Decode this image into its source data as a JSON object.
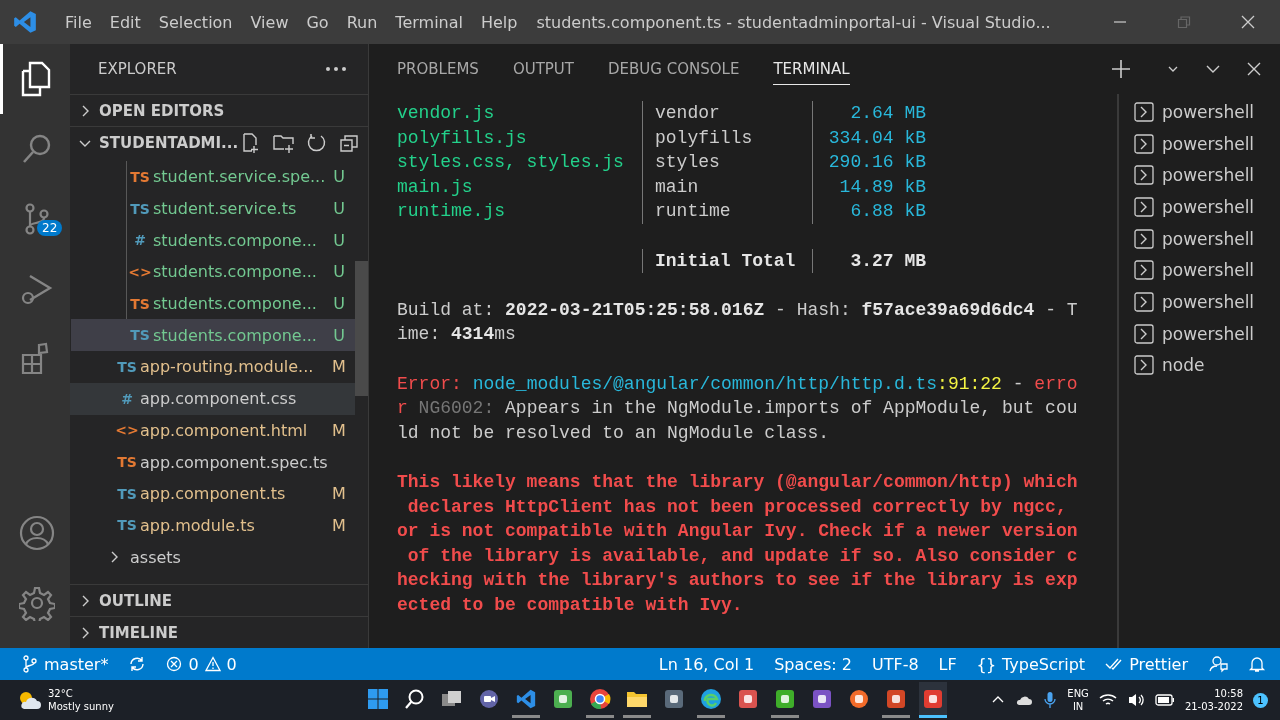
{
  "window": {
    "title": "students.component.ts - studentadminportal-ui - Visual Studio...",
    "menu": [
      "File",
      "Edit",
      "Selection",
      "View",
      "Go",
      "Run",
      "Terminal",
      "Help"
    ]
  },
  "activity_bar": {
    "items": [
      {
        "kind": "explorer",
        "selected": true
      },
      {
        "kind": "search",
        "selected": false
      },
      {
        "kind": "scm",
        "selected": false,
        "badge": "22"
      },
      {
        "kind": "debug",
        "selected": false
      },
      {
        "kind": "extensions",
        "selected": false
      }
    ],
    "bottom": [
      {
        "kind": "account"
      },
      {
        "kind": "settings"
      }
    ]
  },
  "sidebar": {
    "title": "EXPLORER",
    "sections": [
      {
        "title": "OPEN EDITORS",
        "expanded": false
      },
      {
        "title": "STUDENTADMI...",
        "expanded": true
      }
    ],
    "tree": [
      {
        "children": [
          {
            "icon": "TS",
            "color": "#e37933",
            "name": "student.service.spe...",
            "status": "U",
            "kind": "untracked",
            "selected": false,
            "hovered": false
          },
          {
            "icon": "TS",
            "color": "#519aba",
            "name": "student.service.ts",
            "status": "U",
            "kind": "untracked",
            "selected": false,
            "hovered": false
          },
          {
            "icon": "#",
            "color": "#519aba",
            "name": "students.compone...",
            "status": "U",
            "kind": "untracked",
            "selected": false,
            "hovered": false
          },
          {
            "icon": "<>",
            "color": "#e37933",
            "name": "students.compone...",
            "status": "U",
            "kind": "untracked",
            "selected": false,
            "hovered": false
          },
          {
            "icon": "TS",
            "color": "#e37933",
            "name": "students.compone...",
            "status": "U",
            "kind": "untracked",
            "selected": false,
            "hovered": false
          },
          {
            "icon": "TS",
            "color": "#519aba",
            "name": "students.compone...",
            "status": "U",
            "kind": "untracked",
            "selected": true,
            "hovered": false
          }
        ]
      },
      {
        "icon": "TS",
        "color": "#519aba",
        "name": "app-routing.module...",
        "status": "M",
        "kind": "modified",
        "selected": false,
        "hovered": false
      },
      {
        "icon": "#",
        "color": "#519aba",
        "name": "app.component.css",
        "kind": "clean",
        "selected": false,
        "hovered": true
      },
      {
        "icon": "<>",
        "color": "#e37933",
        "name": "app.component.html",
        "status": "M",
        "kind": "modified",
        "selected": false,
        "hovered": false
      },
      {
        "icon": "TS",
        "color": "#e37933",
        "name": "app.component.spec.ts",
        "kind": "clean",
        "selected": false,
        "hovered": false
      },
      {
        "icon": "TS",
        "color": "#519aba",
        "name": "app.component.ts",
        "status": "M",
        "kind": "modified",
        "selected": false,
        "hovered": false
      },
      {
        "icon": "TS",
        "color": "#519aba",
        "name": "app.module.ts",
        "status": "M",
        "kind": "modified",
        "selected": false,
        "hovered": false
      },
      {
        "name": "assets",
        "kind": "clean",
        "expanded": false,
        "selected": false,
        "hovered": false
      }
    ],
    "bottom_sections": [
      {
        "title": "OUTLINE",
        "expanded": false
      },
      {
        "title": "TIMELINE",
        "expanded": false
      }
    ]
  },
  "panel": {
    "tabs": [
      {
        "label": "PROBLEMS",
        "selected": false
      },
      {
        "label": "OUTPUT",
        "selected": false
      },
      {
        "label": "DEBUG CONSOLE",
        "selected": false
      },
      {
        "label": "TERMINAL",
        "selected": true
      }
    ],
    "bundles": [
      {
        "file": "vendor.js",
        "chunk": "vendor",
        "size": "2.64 MB"
      },
      {
        "file": "polyfills.js",
        "chunk": "polyfills",
        "size": "334.04 kB"
      },
      {
        "file": "styles.css, styles.js",
        "chunk": "styles",
        "size": "290.16 kB"
      },
      {
        "file": "main.js",
        "chunk": "main",
        "size": "14.89 kB"
      },
      {
        "file": "runtime.js",
        "chunk": "runtime",
        "size": "6.88 kB"
      }
    ],
    "total": {
      "label": "Initial Total",
      "size": "3.27 MB"
    },
    "blocks": [
      [
        [
          {
            "kind": "plain",
            "text": "Build at: "
          },
          {
            "kind": "bold",
            "text": "2022-03-21T05:25:58.016Z"
          },
          {
            "kind": "plain",
            "text": " - Hash: "
          },
          {
            "kind": "bold",
            "text": "f57ace39a69d6dc4"
          },
          {
            "kind": "plain",
            "text": " - T"
          }
        ],
        [
          {
            "kind": "plain",
            "text": "ime: "
          },
          {
            "kind": "bold",
            "text": "4314"
          },
          {
            "kind": "plain",
            "text": "ms"
          }
        ]
      ],
      [
        [
          {
            "kind": "red",
            "text": "Error: "
          },
          {
            "kind": "cyan",
            "text": "node_modules/@angular/common/http/http.d.ts"
          },
          {
            "kind": "yellow",
            "text": ":91:22"
          },
          {
            "kind": "plain",
            "text": " - "
          },
          {
            "kind": "red",
            "text": "erro"
          }
        ],
        [
          {
            "kind": "red",
            "text": "r"
          },
          {
            "kind": "grey",
            "text": " NG6002:"
          },
          {
            "kind": "plain",
            "text": " Appears in the NgModule.imports of AppModule, but cou"
          }
        ],
        [
          {
            "kind": "plain",
            "text": "ld not be resolved to an NgModule class."
          }
        ]
      ],
      [
        [
          {
            "kind": "redbold",
            "text": "This likely means that the library (@angular/common/http) which"
          }
        ],
        [
          {
            "kind": "redbold",
            "text": " declares HttpClient has not been processed correctly by ngcc,"
          }
        ],
        [
          {
            "kind": "redbold",
            "text": "or is not compatible with Angular Ivy. Check if a newer version"
          }
        ],
        [
          {
            "kind": "redbold",
            "text": " of the library is available, and update if so. Also consider c"
          }
        ],
        [
          {
            "kind": "redbold",
            "text": "hecking with the library's authors to see if the library is exp"
          }
        ],
        [
          {
            "kind": "redbold",
            "text": "ected to be compatible with Ivy."
          }
        ]
      ]
    ],
    "terminals": [
      {
        "name": "powershell",
        "selected": false
      },
      {
        "name": "powershell",
        "selected": false
      },
      {
        "name": "powershell",
        "selected": false
      },
      {
        "name": "powershell",
        "selected": false
      },
      {
        "name": "powershell",
        "selected": false
      },
      {
        "name": "powershell",
        "selected": false
      },
      {
        "name": "powershell",
        "selected": false
      },
      {
        "name": "powershell",
        "selected": false
      },
      {
        "name": "node",
        "selected": false
      }
    ]
  },
  "status_bar": {
    "branch": "master*",
    "errors": "0",
    "warnings": "0",
    "right": [
      {
        "kind": "text",
        "text": "Ln 16, Col 1"
      },
      {
        "kind": "text",
        "text": "Spaces: 2"
      },
      {
        "kind": "text",
        "text": "UTF-8"
      },
      {
        "kind": "text",
        "text": "LF"
      },
      {
        "kind": "braces",
        "text": "TypeScript",
        "glyph": "{}"
      },
      {
        "kind": "checks",
        "text": "Prettier"
      },
      {
        "kind": "feedback"
      },
      {
        "kind": "bell"
      }
    ]
  },
  "taskbar": {
    "weather": {
      "temp": "32°C",
      "text": "Mostly sunny"
    },
    "apps": [
      {
        "kind": "windows",
        "running": false,
        "selected": false
      },
      {
        "kind": "search",
        "running": false,
        "selected": false
      },
      {
        "kind": "taskview",
        "running": false,
        "selected": false
      },
      {
        "kind": "chat",
        "running": false,
        "selected": false
      },
      {
        "kind": "vscode",
        "running": true,
        "selected": false
      },
      {
        "kind": "notepad",
        "running": false,
        "selected": false
      },
      {
        "kind": "chrome",
        "running": true,
        "selected": false
      },
      {
        "kind": "folder",
        "running": true,
        "selected": false
      },
      {
        "kind": "calculator",
        "running": false,
        "selected": false
      },
      {
        "kind": "edge",
        "running": true,
        "selected": false
      },
      {
        "kind": "snip",
        "running": false,
        "selected": false
      },
      {
        "kind": "greenapp",
        "running": true,
        "selected": false
      },
      {
        "kind": "purpleapp",
        "running": false,
        "selected": false
      },
      {
        "kind": "compass",
        "running": false,
        "selected": false
      },
      {
        "kind": "slides",
        "running": true,
        "selected": false
      },
      {
        "kind": "redapp",
        "running": true,
        "selected": true
      }
    ],
    "lang": "ENG",
    "region": "IN",
    "time": "10:58",
    "date": "21-03-2022",
    "notifications": "1"
  }
}
